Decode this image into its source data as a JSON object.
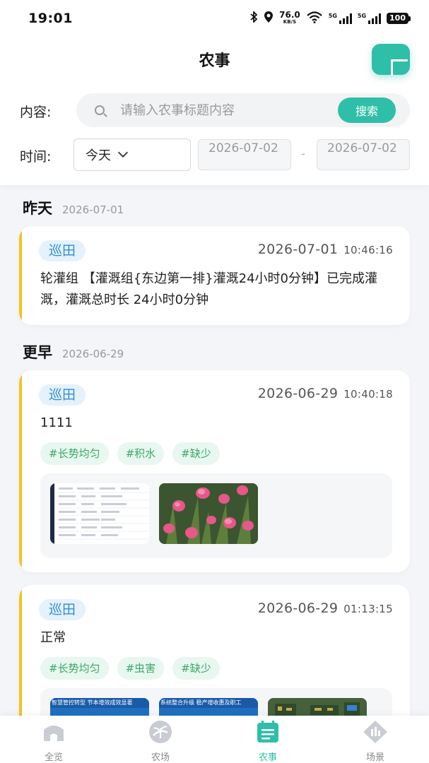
{
  "status_bar": {
    "time": "19:01",
    "net_speed_value": "76.0",
    "net_speed_unit": "KB/S",
    "sim1": "5G",
    "sim2": "5G",
    "battery": "100"
  },
  "header": {
    "title": "农事",
    "add_icon": "plus-icon"
  },
  "filters": {
    "content_label": "内容:",
    "search_placeholder": "请输入农事标题内容",
    "search_value": "",
    "search_button": "搜索",
    "time_label": "时间:",
    "time_range_selected": "今天",
    "date_start": "2026-07-02",
    "date_separator": "-",
    "date_end": "2026-07-02"
  },
  "sections": [
    {
      "title": "昨天",
      "date": "2026-07-01",
      "records": [
        {
          "type": "巡田",
          "date": "2026-07-01",
          "time": "10:46:16",
          "text": "轮灌组 【灌溉组{东边第一排}灌溉24小时0分钟】已完成灌溉，灌溉总时长 24小时0分钟"
        }
      ]
    },
    {
      "title": "更早",
      "date": "2026-06-29",
      "records": [
        {
          "type": "巡田",
          "date": "2026-06-29",
          "time": "10:40:18",
          "text": "1111",
          "tags": [
            "#长势均匀",
            "#积水",
            "#缺少"
          ],
          "photos": [
            "table-screenshot-image",
            "tulip-flowers-image"
          ]
        },
        {
          "type": "巡田",
          "date": "2026-06-29",
          "time": "01:13:15",
          "text": "正常",
          "tags": [
            "#长势均匀",
            "#虫害",
            "#缺少"
          ],
          "photos": [
            "smart-management-banner-image",
            "system-upgrade-banner-image",
            "circuit-board-image"
          ],
          "photo_captions": [
            "智慧管控转型  节本增效成效显著",
            "系统整合升级  稳产增收惠及职工"
          ]
        }
      ]
    }
  ],
  "tabbar": {
    "items": [
      {
        "label": "全览",
        "icon": "home-icon",
        "active": false
      },
      {
        "label": "农场",
        "icon": "farm-icon",
        "active": false
      },
      {
        "label": "农事",
        "icon": "farm-records-icon",
        "active": true
      },
      {
        "label": "场景",
        "icon": "scene-icon",
        "active": false
      }
    ]
  },
  "colors": {
    "accent": "#2fbfa8",
    "card_stripe": "#f6c21c",
    "type_tag_bg": "#e5f2fb",
    "type_tag_text": "#2d8fd6",
    "hashtag_bg": "#e8f7ef",
    "hashtag_text": "#3aa867"
  }
}
